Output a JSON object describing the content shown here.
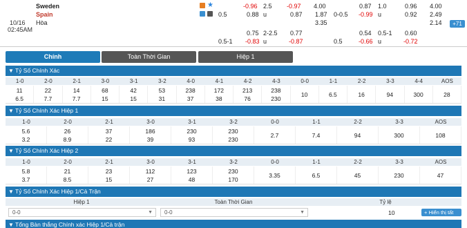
{
  "match": {
    "home": "Sweden",
    "away": "Spain",
    "draw": "Hòa",
    "date": "10/16",
    "time": "02:45AM",
    "more": "+71"
  },
  "odds": {
    "r1": {
      "a": "-0.96",
      "b": "2.5",
      "c": "-0.97",
      "d": "4.00",
      "e": "0.87",
      "f": "1.0",
      "g": "0.96",
      "h": "4.00"
    },
    "r2": {
      "hc": "0.5",
      "a": "0.88",
      "u": "u",
      "b": "0.87",
      "c": "1.87",
      "hc2": "0-0.5",
      "d": "-0.99",
      "u2": "u",
      "e": "0.92",
      "f": "2.49"
    },
    "r3": {
      "a": "3.35",
      "b": "2.14"
    },
    "r4": {
      "a": "0.75",
      "b": "2-2.5",
      "c": "0.77",
      "d": "0.54",
      "e": "0.5-1",
      "f": "0.60"
    },
    "r5": {
      "hc": "0.5-1",
      "a": "-0.83",
      "u": "u",
      "b": "-0.87",
      "hc2": "0.5",
      "c": "-0.66",
      "u2": "u",
      "d": "-0.72"
    }
  },
  "tabs": [
    "Chính",
    "Toàn Thời Gian",
    "Hiệp 1"
  ],
  "sections": {
    "s1": {
      "title": "Tỷ Số Chính Xác",
      "headers": [
        "1-0",
        "2-0",
        "2-1",
        "3-0",
        "3-1",
        "3-2",
        "4-0",
        "4-1",
        "4-2",
        "4-3",
        "0-0",
        "1-1",
        "2-2",
        "3-3",
        "4-4",
        "AOS"
      ],
      "top": [
        "11",
        "22",
        "14",
        "68",
        "42",
        "53",
        "238",
        "172",
        "213",
        "238",
        "10",
        "6.5",
        "16",
        "94",
        "300",
        "28"
      ],
      "bottom": [
        "6.5",
        "7.7",
        "7.7",
        "15",
        "15",
        "31",
        "37",
        "38",
        "76",
        "230",
        "",
        "",
        "",
        "",
        "",
        ""
      ]
    },
    "s2": {
      "title": "Tỷ Số Chính Xác Hiệp 1",
      "headers": [
        "1-0",
        "2-0",
        "2-1",
        "3-0",
        "3-1",
        "3-2",
        "0-0",
        "1-1",
        "2-2",
        "3-3",
        "AOS"
      ],
      "top": [
        "5.6",
        "26",
        "37",
        "186",
        "230",
        "230",
        "2.7",
        "7.4",
        "94",
        "300",
        "108"
      ],
      "bottom": [
        "3.2",
        "8.9",
        "22",
        "39",
        "93",
        "230",
        "",
        "",
        "",
        "",
        ""
      ]
    },
    "s3": {
      "title": "Tỷ Số Chính Xác Hiệp 2",
      "headers": [
        "1-0",
        "2-0",
        "2-1",
        "3-0",
        "3-1",
        "3-2",
        "0-0",
        "1-1",
        "2-2",
        "3-3",
        "AOS"
      ],
      "top": [
        "5.8",
        "21",
        "23",
        "112",
        "123",
        "230",
        "3.35",
        "6.5",
        "45",
        "230",
        "47"
      ],
      "bottom": [
        "3.7",
        "8.5",
        "15",
        "27",
        "48",
        "170",
        "",
        "",
        "",
        "",
        ""
      ]
    },
    "s4": {
      "title": "Tỷ Số Chính Xác Hiệp 1/Cả Trận",
      "headers": [
        "Hiệp 1",
        "Toàn Thời Gian",
        "Tỷ lệ"
      ],
      "sel1": "0-0",
      "sel2": "0-0",
      "rate": "10",
      "button": "+ Hiển thị tất cả"
    },
    "s5": {
      "title": "Tổng Bàn thắng Chính xác Hiệp 1/Cả trận"
    }
  },
  "colors": {
    "accent": "#1e77b5",
    "negative": "#e00000",
    "tab_inactive": "#555555"
  },
  "icons": [
    "rss-icon",
    "star-icon",
    "chart-icon",
    "tv-icon",
    "chevron-down-icon"
  ]
}
